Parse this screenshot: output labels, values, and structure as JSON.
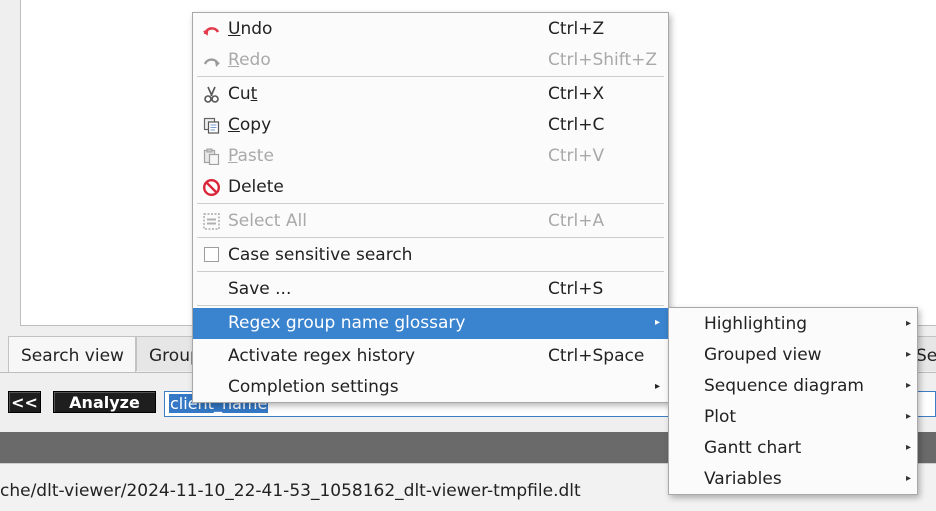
{
  "tabs": [
    {
      "label": "Search view"
    },
    {
      "label": "Grouped view"
    },
    {
      "label": "Sequence view"
    }
  ],
  "search": {
    "back_label": "<<",
    "analyze_label": "Analyze",
    "value": "client_name"
  },
  "status": {
    "path": "che/dlt-viewer/2024-11-10_22-41-53_1058162_dlt-viewer-tmpfile.dlt"
  },
  "menu": {
    "undo": {
      "label": "Undo",
      "shortcut": "Ctrl+Z",
      "icon": "undo-icon"
    },
    "redo": {
      "label": "Redo",
      "shortcut": "Ctrl+Shift+Z",
      "icon": "redo-icon"
    },
    "cut": {
      "label": "Cut",
      "shortcut": "Ctrl+X",
      "icon": "scissors-icon"
    },
    "copy": {
      "label": "Copy",
      "shortcut": "Ctrl+C",
      "icon": "copy-icon"
    },
    "paste": {
      "label": "Paste",
      "shortcut": "Ctrl+V",
      "icon": "paste-icon"
    },
    "delete": {
      "label": "Delete",
      "icon": "delete-icon"
    },
    "select_all": {
      "label": "Select All",
      "shortcut": "Ctrl+A",
      "icon": "select-all-icon"
    },
    "case_sensitive": {
      "label": "Case sensitive search",
      "checked": false
    },
    "save": {
      "label": "Save ...",
      "shortcut": "Ctrl+S"
    },
    "regex_glossary": {
      "label": "Regex group name glossary"
    },
    "regex_history": {
      "label": "Activate regex history",
      "shortcut": "Ctrl+Space"
    },
    "completion": {
      "label": "Completion settings"
    }
  },
  "submenu": {
    "items": [
      {
        "label": "Highlighting"
      },
      {
        "label": "Grouped view"
      },
      {
        "label": "Sequence diagram"
      },
      {
        "label": "Plot"
      },
      {
        "label": "Gantt chart"
      },
      {
        "label": "Variables"
      }
    ]
  },
  "colors": {
    "highlight": "#3a83cf",
    "undo_icon": "#e23a4b",
    "delete_icon": "#d9263a"
  }
}
